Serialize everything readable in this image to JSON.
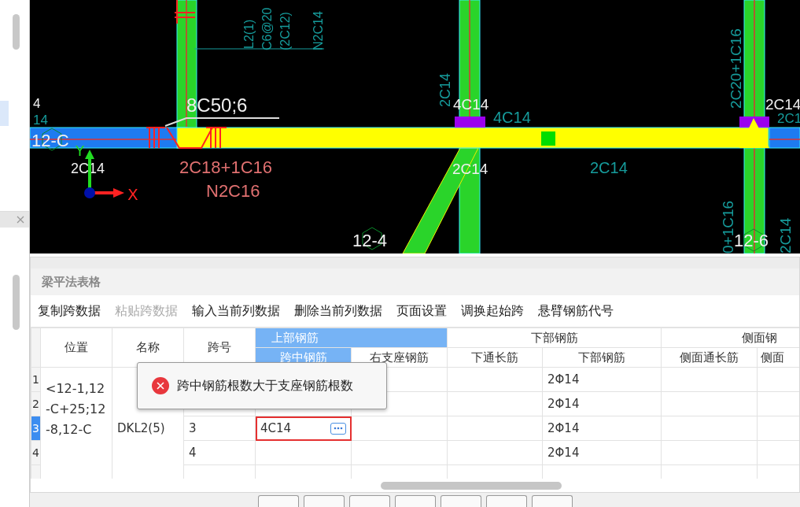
{
  "cad_view": {
    "labels": [
      {
        "text": "4",
        "kind": "white"
      },
      {
        "text": "14",
        "kind": "teal"
      },
      {
        "text": "12-C",
        "kind": "white"
      },
      {
        "text": "8C50;6",
        "kind": "white"
      },
      {
        "text": "2C14",
        "kind": "white"
      },
      {
        "text": "2C18+1C16",
        "kind": "red"
      },
      {
        "text": "N2C16",
        "kind": "red"
      },
      {
        "text": "L2(1)",
        "kind": "teal"
      },
      {
        "text": "C6@20",
        "kind": "teal"
      },
      {
        "text": "(2C12)",
        "kind": "teal"
      },
      {
        "text": "N2C14",
        "kind": "teal"
      },
      {
        "text": "2C14",
        "kind": "teal"
      },
      {
        "text": "4C14",
        "kind": "white"
      },
      {
        "text": "4C14",
        "kind": "teal"
      },
      {
        "text": "2C14",
        "kind": "white"
      },
      {
        "text": "2C14",
        "kind": "teal"
      },
      {
        "text": "2C20+1C16",
        "kind": "teal"
      },
      {
        "text": "2C14",
        "kind": "white"
      },
      {
        "text": "12-4",
        "kind": "white"
      },
      {
        "text": "12-6",
        "kind": "white"
      },
      {
        "text": "2C1",
        "kind": "teal"
      },
      {
        "text": "0+1C16",
        "kind": "teal"
      },
      {
        "text": "2C14",
        "kind": "teal"
      }
    ],
    "axis": {
      "x": "X",
      "y": "Y"
    }
  },
  "beam_table": {
    "title": "梁平法表格",
    "toolbar": [
      {
        "label": "复制跨数据",
        "disabled": false
      },
      {
        "label": "粘贴跨数据",
        "disabled": true
      },
      {
        "label": "输入当前列数据",
        "disabled": false
      },
      {
        "label": "删除当前列数据",
        "disabled": false
      },
      {
        "label": "页面设置",
        "disabled": false
      },
      {
        "label": "调换起始跨",
        "disabled": false
      },
      {
        "label": "悬臂钢筋代号",
        "disabled": false
      }
    ],
    "fixed_columns": [
      "位置",
      "名称",
      "跨号"
    ],
    "column_groups": [
      {
        "label": "上部钢筋",
        "selected": true
      },
      {
        "label": "下部钢筋",
        "selected": false
      },
      {
        "label": "侧面钢",
        "selected": false
      }
    ],
    "columns": [
      {
        "label": "跨中钢筋",
        "selected": true
      },
      {
        "label": "右支座钢筋",
        "selected": false
      },
      {
        "label": "下通长筋",
        "selected": false
      },
      {
        "label": "下部钢筋",
        "selected": false
      },
      {
        "label": "侧面通长筋",
        "selected": false
      },
      {
        "label": "侧面",
        "selected": false
      }
    ],
    "position": "<12-1,12-C+25;12-8,12-C",
    "name": "DKL2(5)",
    "rows": [
      {
        "number": "1",
        "selected": false,
        "bottom": "2Φ14"
      },
      {
        "number": "2",
        "selected": false,
        "bottom": "2Φ14"
      },
      {
        "number": "3",
        "selected": true,
        "span": "3",
        "top_mid": "4C14",
        "editing": true,
        "bottom": "2Φ14"
      },
      {
        "number": "4",
        "selected": false,
        "span": "4",
        "editing": false,
        "bottom": "2Φ14"
      }
    ],
    "error_tooltip": "跨中钢筋根数大于支座钢筋根数"
  }
}
